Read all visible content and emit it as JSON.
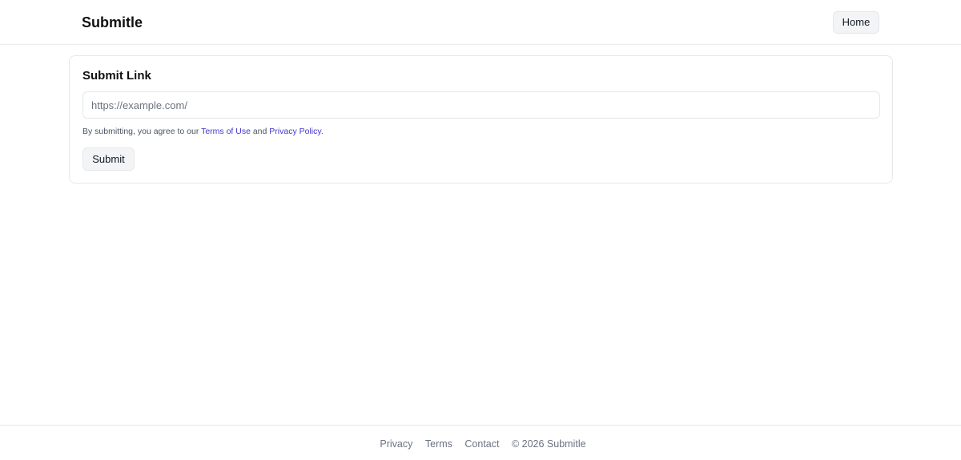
{
  "header": {
    "brand": "Submitle",
    "home_label": "Home"
  },
  "card": {
    "title": "Submit Link",
    "url_placeholder": "https://example.com/",
    "url_value": "",
    "consent_prefix": "By submitting, you agree to our ",
    "terms_label": "Terms of Use",
    "consent_and": " and ",
    "privacy_label": "Privacy Policy",
    "consent_suffix": ".",
    "submit_label": "Submit"
  },
  "footer": {
    "privacy_label": "Privacy",
    "terms_label": "Terms",
    "contact_label": "Contact",
    "copyright": "© 2026 Submitle"
  },
  "colors": {
    "link": "#4338ca",
    "button_bg": "#f3f4f6",
    "border": "#e5e7eb",
    "muted_text": "#6b7280"
  }
}
